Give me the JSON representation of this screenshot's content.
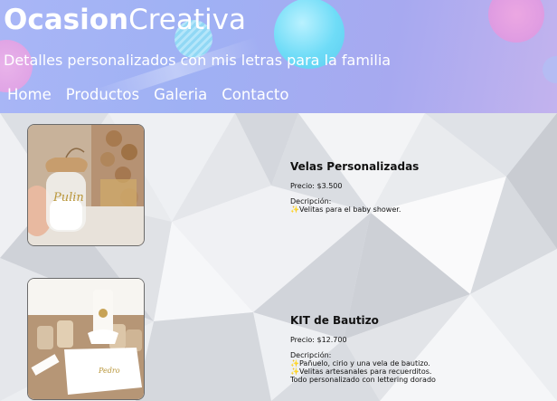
{
  "header": {
    "title_part1": "Ocasion",
    "title_part2": "Creativa",
    "tagline": "Detalles personalizados con mis letras para la familia"
  },
  "nav": {
    "items": [
      {
        "label": "Home"
      },
      {
        "label": "Productos"
      },
      {
        "label": "Galeria"
      },
      {
        "label": "Contacto"
      }
    ]
  },
  "products": [
    {
      "name": "Velas Personalizadas",
      "price": "Precio: $3.500",
      "desc_label": "Decripción:",
      "lines": [
        "Velitas para el baby shower."
      ],
      "image_icon": "candle-jar-photo",
      "image_text": "Pulin"
    },
    {
      "name": "KIT de Bautizo",
      "price": "Precio: $12.700",
      "desc_label": "Decripción:",
      "lines": [
        "Pañuelo, cirio y una vela de bautizo.",
        "Velitas artesanales para recuerditos.",
        "Todo personalizado con lettering dorado"
      ],
      "image_icon": "baptism-kit-photo"
    }
  ],
  "colors": {
    "header_gradient_start": "#a9b6f6",
    "header_gradient_end": "#c3b3ee",
    "text_dark": "#111111",
    "sparkle": "#c9a800"
  }
}
